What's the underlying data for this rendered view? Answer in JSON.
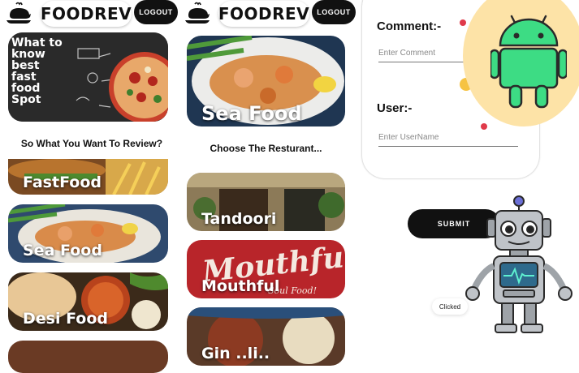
{
  "screens": [
    {
      "brand": "FOODREV",
      "logout": "LOGOUT",
      "hero_text": "What to\nknow\nbest\nfast\nfood\nSpot",
      "heading": "So What You Want To Review?",
      "categories": [
        "FastFood",
        "Sea Food",
        "Desi Food"
      ]
    },
    {
      "brand": "FOODREV",
      "logout": "LOGOUT",
      "hero_label": "Sea Food",
      "heading": "Choose The Resturant...",
      "restaurants": [
        "Tandoori",
        "Mouthful",
        "Gin ..li.."
      ]
    }
  ],
  "form": {
    "comment_label": "Comment:-",
    "comment_placeholder": "Enter Comment",
    "user_label": "User:-",
    "user_placeholder": "Enter UserName",
    "submit": "SUBMIT",
    "toast": "Clicked"
  },
  "colors": {
    "dark": "#111111",
    "android_green": "#3ddc84",
    "android_bg": "#fde3a7",
    "dot_red": "#e03a4a",
    "dot_yellow": "#f6c343"
  },
  "icons": [
    "roast-chicken-icon",
    "android-logo-icon",
    "robot-mascot-icon"
  ]
}
